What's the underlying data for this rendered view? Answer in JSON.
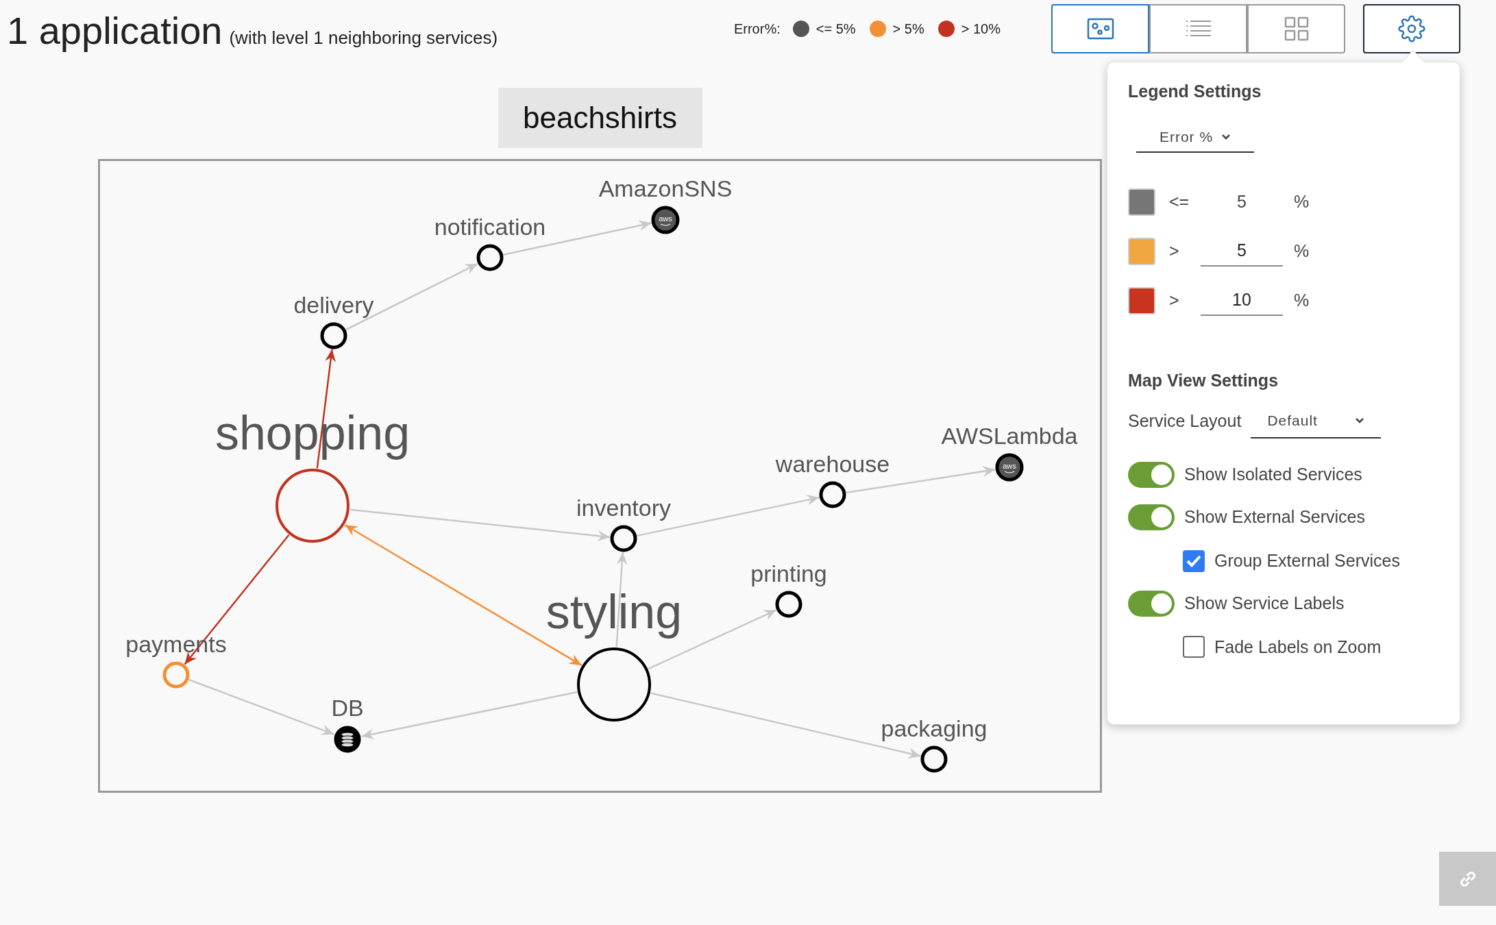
{
  "header": {
    "title": "1 application",
    "subtitle": "(with level 1 neighboring services)"
  },
  "legend": {
    "label": "Error%:",
    "items": [
      {
        "label": "<= 5%",
        "color": "#555555"
      },
      {
        "label": "> 5%",
        "color": "#f39035"
      },
      {
        "label": "> 10%",
        "color": "#c1331f"
      }
    ]
  },
  "view_buttons": [
    {
      "kind": "map",
      "selected": true
    },
    {
      "kind": "list",
      "selected": false
    },
    {
      "kind": "grid",
      "selected": false
    }
  ],
  "settings_button": {
    "selected": true
  },
  "application": {
    "name": "beachshirts"
  },
  "map": {
    "nodes": [
      {
        "name": "AmazonSNS",
        "kind": "aws",
        "icon_text": "aws",
        "color": "#000000"
      },
      {
        "name": "notification",
        "kind": "service",
        "color": "#000000"
      },
      {
        "name": "delivery",
        "kind": "service",
        "color": "#000000"
      },
      {
        "name": "shopping",
        "kind": "app",
        "color": "#c1331f"
      },
      {
        "name": "inventory",
        "kind": "service",
        "color": "#000000"
      },
      {
        "name": "warehouse",
        "kind": "service",
        "color": "#000000"
      },
      {
        "name": "AWSLambda",
        "kind": "aws",
        "icon_text": "aws",
        "color": "#000000"
      },
      {
        "name": "printing",
        "kind": "service",
        "color": "#000000"
      },
      {
        "name": "styling",
        "kind": "app",
        "color": "#000000"
      },
      {
        "name": "payments",
        "kind": "service",
        "color": "#f39035"
      },
      {
        "name": "DB",
        "kind": "database",
        "color": "#000000"
      },
      {
        "name": "packaging",
        "kind": "service",
        "color": "#000000"
      }
    ],
    "edges": [
      {
        "color": "#c8c8c8",
        "bidirectional": false
      },
      {
        "color": "#c8c8c8",
        "bidirectional": false
      },
      {
        "color": "#c1331f",
        "bidirectional": false
      },
      {
        "color": "#c8c8c8",
        "bidirectional": false
      },
      {
        "color": "#c8c8c8",
        "bidirectional": false
      },
      {
        "color": "#c8c8c8",
        "bidirectional": false
      },
      {
        "color": "#c8c8c8",
        "bidirectional": false
      },
      {
        "color": "#c8c8c8",
        "bidirectional": false
      },
      {
        "color": "#c8c8c8",
        "bidirectional": false
      },
      {
        "color": "#c8c8c8",
        "bidirectional": false
      },
      {
        "color": "#c1331f",
        "bidirectional": false
      },
      {
        "color": "#c8c8c8",
        "bidirectional": false
      },
      {
        "color": "#f39035",
        "bidirectional": true
      }
    ]
  },
  "settings_panel": {
    "title": "Legend Settings",
    "metric": "Error %",
    "thresholds": [
      {
        "color": "#767676",
        "operator": "<=",
        "value": "5",
        "unit": "%",
        "editable": false
      },
      {
        "color": "#f2a641",
        "operator": ">",
        "value": "5",
        "unit": "%",
        "editable": true
      },
      {
        "color": "#c9341f",
        "operator": ">",
        "value": "10",
        "unit": "%",
        "editable": true
      }
    ],
    "map_title": "Map View Settings",
    "layout_label": "Service Layout",
    "layout_value": "Default",
    "options": [
      {
        "kind": "toggle",
        "label": "Show Isolated Services",
        "on": true
      },
      {
        "kind": "toggle",
        "label": "Show External Services",
        "on": true,
        "children": [
          {
            "kind": "checkbox",
            "label": "Group External Services",
            "checked": true
          }
        ]
      },
      {
        "kind": "toggle",
        "label": "Show Service Labels",
        "on": true,
        "children": [
          {
            "kind": "checkbox",
            "label": "Fade Labels on Zoom",
            "checked": false
          }
        ]
      }
    ]
  }
}
